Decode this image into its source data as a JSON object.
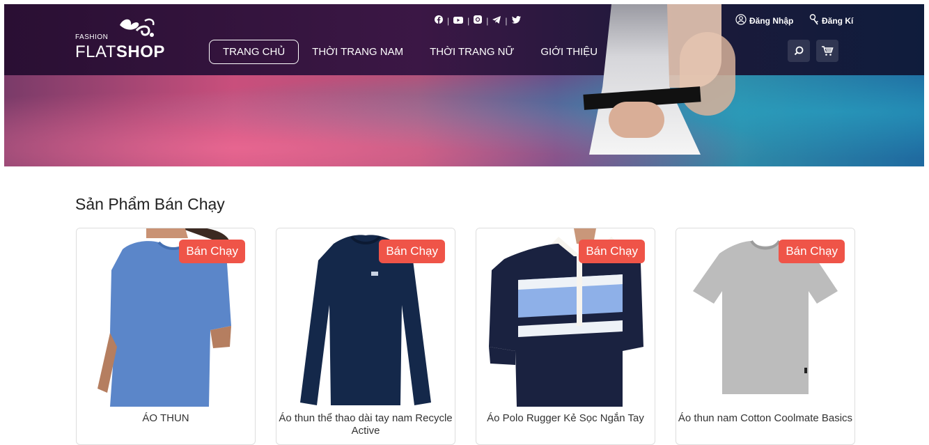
{
  "logo": {
    "fashion": "FASHION",
    "flat": "FLAT",
    "shop": "SHOP"
  },
  "header": {
    "social": [
      "facebook-icon",
      "youtube-icon",
      "instagram-icon",
      "telegram-icon",
      "twitter-icon"
    ],
    "separator": "|",
    "login": "Đăng Nhập",
    "register": "Đăng Kí"
  },
  "nav": {
    "items": [
      {
        "label": "TRANG CHỦ",
        "active": true
      },
      {
        "label": "THỜI TRANG NAM"
      },
      {
        "label": "THỜI TRANG NỮ"
      },
      {
        "label": "GIỚI THIỆU"
      }
    ]
  },
  "section": {
    "title": "Sản Phẩm Bán Chạy"
  },
  "products": [
    {
      "name": "ÁO THUN",
      "badge": "Bán Chạy"
    },
    {
      "name": "Áo thun thể thao dài tay nam Recycle Active",
      "badge": "Bán Chạy"
    },
    {
      "name": "Áo Polo Rugger Kẻ Sọc Ngắn Tay",
      "badge": "Bán Chạy"
    },
    {
      "name": "Áo thun nam Cotton Coolmate Basics",
      "badge": "Bán Chạy"
    }
  ],
  "colors": {
    "badge": "#ef5448",
    "header_dark": "#2a0f33"
  }
}
